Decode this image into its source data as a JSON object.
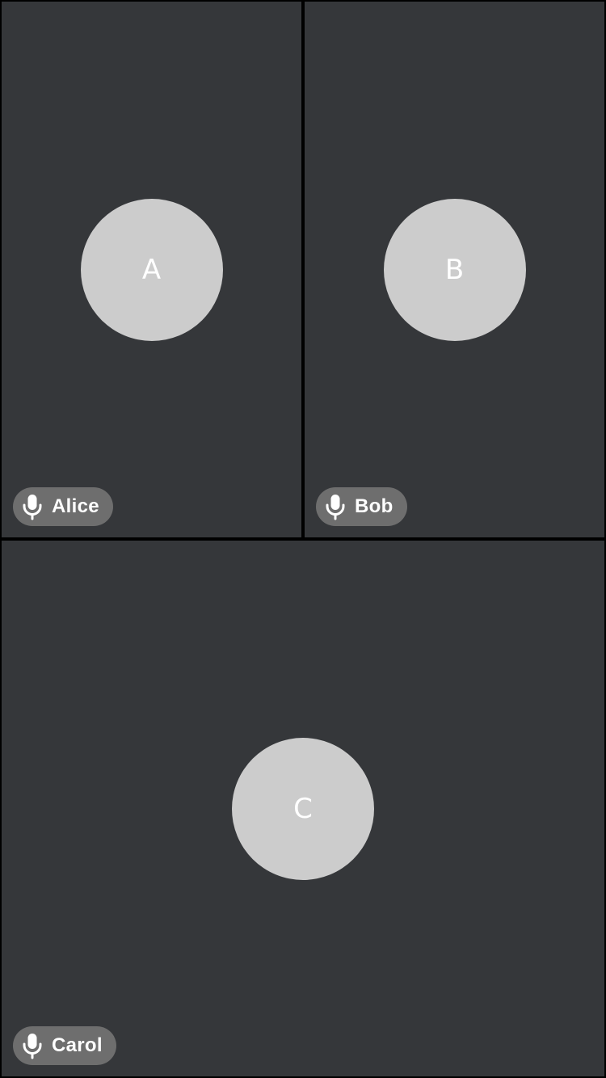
{
  "participants": [
    {
      "name": "Alice",
      "initial": "A",
      "mic_icon": "microphone-icon"
    },
    {
      "name": "Bob",
      "initial": "B",
      "mic_icon": "microphone-icon"
    },
    {
      "name": "Carol",
      "initial": "C",
      "mic_icon": "microphone-icon"
    }
  ],
  "colors": {
    "background": "#000000",
    "tile": "#35373a",
    "avatar": "#cccccc",
    "name_pill": "#6e6e6e",
    "text": "#ffffff"
  }
}
